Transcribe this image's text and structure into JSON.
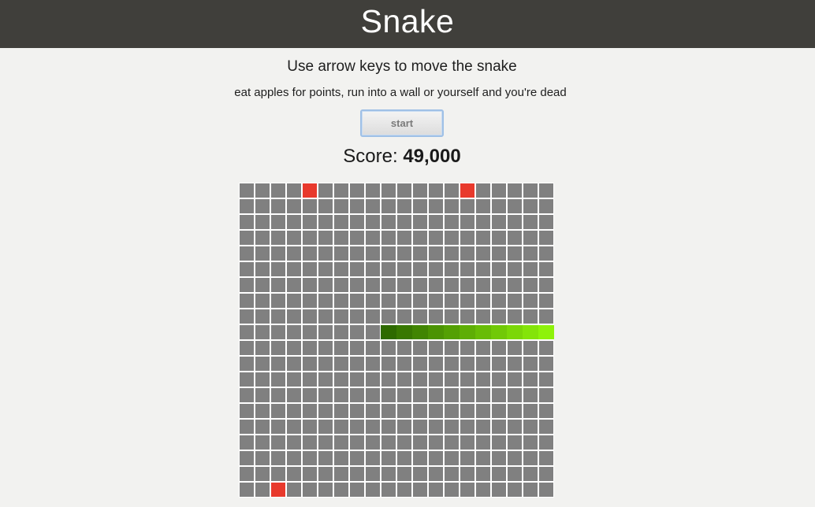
{
  "header": {
    "title": "Snake"
  },
  "instructions": {
    "main": "Use arrow keys to move the snake",
    "sub": "eat apples for points, run into a wall or yourself and you're dead"
  },
  "controls": {
    "start_label": "start"
  },
  "score": {
    "label": "Score:",
    "value": "49,000"
  },
  "board": {
    "columns": 20,
    "rows": 20,
    "empty_color": "#808080",
    "grid_line_color": "#ffffff",
    "apple_color": "#e8392c",
    "apples": [
      {
        "col": 4,
        "row": 0
      },
      {
        "col": 14,
        "row": 0
      },
      {
        "col": 2,
        "row": 19
      }
    ],
    "snake": {
      "row": 9,
      "tail_col": 9,
      "head_col": 19,
      "tail_color": "#2e6a00",
      "head_color": "#8ef20a"
    }
  }
}
